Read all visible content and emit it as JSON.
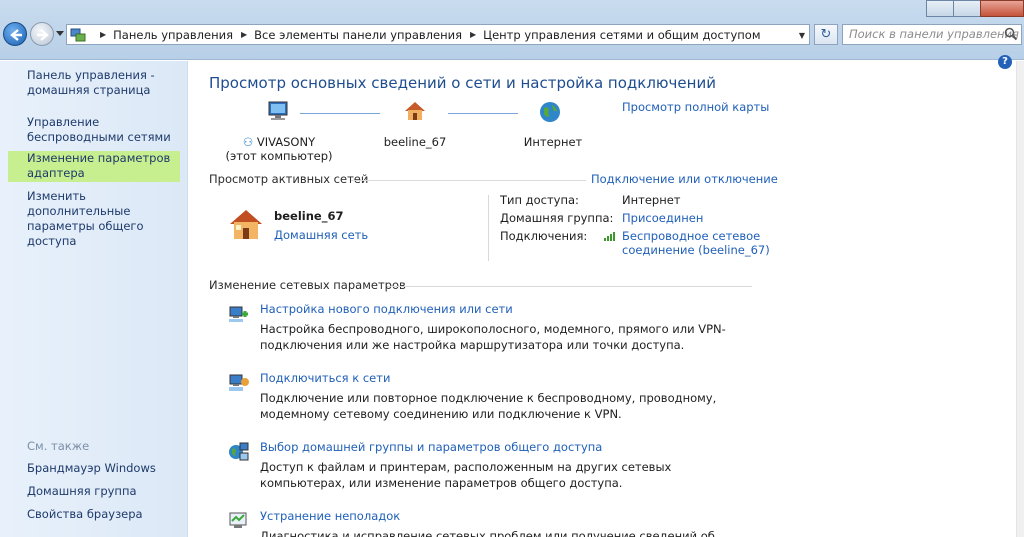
{
  "address_bar": {
    "crumbs": [
      "Панель управления",
      "Все элементы панели управления",
      "Центр управления сетями и общим доступом"
    ],
    "search_placeholder": "Поиск в панели управления"
  },
  "sidebar": {
    "items": [
      {
        "label": "Панель управления - домашняя страница"
      },
      {
        "label": "Управление беспроводными сетями"
      },
      {
        "label": "Изменение параметров адаптера"
      },
      {
        "label": "Изменить дополнительные параметры общего доступа"
      }
    ],
    "see_also_title": "См. также",
    "see_also": [
      "Брандмауэр Windows",
      "Домашняя группа",
      "Свойства браузера"
    ]
  },
  "main": {
    "title": "Просмотр основных сведений о сети и настройка подключений",
    "full_map_link": "Просмотр полной карты",
    "map": {
      "computer_name": "VIVASONY",
      "computer_sub": "(этот компьютер)",
      "network": "beeline_67",
      "internet": "Интернет"
    },
    "active_networks_label": "Просмотр активных сетей",
    "connect_disconnect_link": "Подключение или отключение",
    "active_network": {
      "name": "beeline_67",
      "type_link": "Домашняя сеть",
      "access_type_label": "Тип доступа:",
      "access_type_value": "Интернет",
      "homegroup_label": "Домашняя группа:",
      "homegroup_value": "Присоединен",
      "connections_label": "Подключения:",
      "connections_value_1": "Беспроводное сетевое",
      "connections_value_2": "соединение (beeline_67)"
    },
    "change_settings_label": "Изменение сетевых параметров",
    "tasks": [
      {
        "title": "Настройка нового подключения или сети",
        "desc": "Настройка беспроводного, широкополосного, модемного, прямого или VPN-подключения или же настройка маршрутизатора или точки доступа."
      },
      {
        "title": "Подключиться к сети",
        "desc": "Подключение или повторное подключение к беспроводному, проводному, модемному сетевому соединению или подключение к VPN."
      },
      {
        "title": "Выбор домашней группы и параметров общего доступа",
        "desc": "Доступ к файлам и принтерам, расположенным на других сетевых компьютерах, или изменение параметров общего доступа."
      },
      {
        "title": "Устранение неполадок",
        "desc": "Диагностика и исправление сетевых проблем или получение сведений об исправлении"
      }
    ]
  }
}
